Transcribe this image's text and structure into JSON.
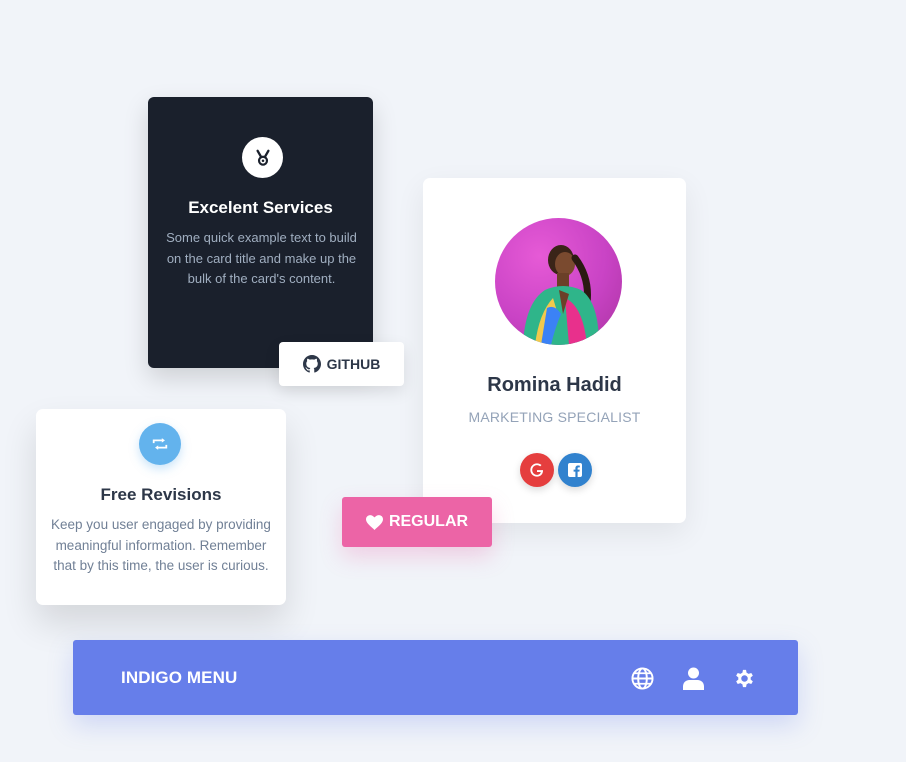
{
  "services_card": {
    "icon": "medal-icon",
    "title": "Excelent Services",
    "text": "Some quick example text to build on the card title and make up the bulk of the card's content."
  },
  "github_button": {
    "icon": "github-icon",
    "label": "GITHUB"
  },
  "profile_card": {
    "name": "Romina Hadid",
    "role": "MARKETING SPECIALIST",
    "social": [
      {
        "icon": "google-icon",
        "color": "#e53e3e"
      },
      {
        "icon": "facebook-icon",
        "color": "#3182ce"
      }
    ]
  },
  "regular_button": {
    "icon": "heart-icon",
    "label": "REGULAR",
    "color": "#ec64a6"
  },
  "revisions_card": {
    "icon": "retweet-icon",
    "title": "Free Revisions",
    "text": "Keep you user engaged by providing meaningful information. Remember that by this time, the user is curious."
  },
  "menu": {
    "brand": "INDIGO MENU",
    "color": "#667eea",
    "icons": [
      "globe-icon",
      "user-icon",
      "gear-icon"
    ]
  },
  "colors": {
    "background": "#f1f4f9",
    "dark_card": "#1a202c"
  }
}
